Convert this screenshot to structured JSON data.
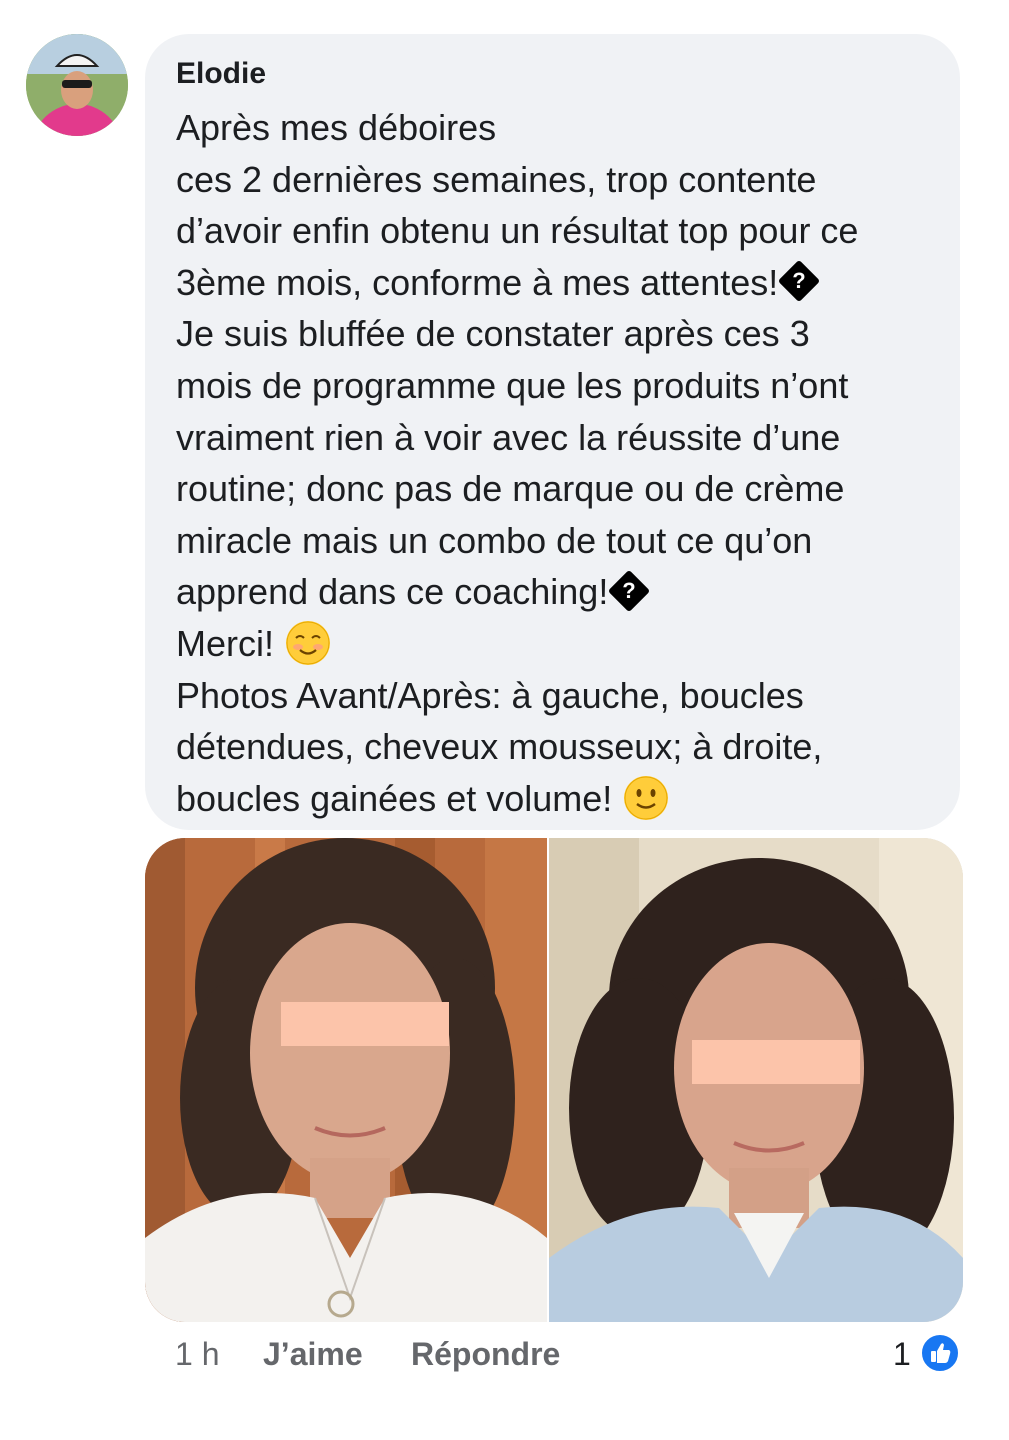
{
  "comment": {
    "author": "Elodie",
    "lines": [
      {
        "text": "Après mes déboires"
      },
      {
        "text": "ces 2 dernières semaines, trop contente"
      },
      {
        "text": "d’avoir enfin obtenu un résultat top pour ce"
      },
      {
        "text": "3ème mois, conforme à mes attentes!",
        "suffix_icon": "question-diamond-icon"
      },
      {
        "text": "Je suis bluffée de constater après ces 3"
      },
      {
        "text": "mois de programme que les produits n’ont"
      },
      {
        "text": "vraiment rien à voir avec la réussite d’une"
      },
      {
        "text": "routine; donc pas de marque ou de crème"
      },
      {
        "text": "miracle mais un combo de tout ce qu’on"
      },
      {
        "text": "apprend dans ce coaching!",
        "suffix_icon": "question-diamond-icon"
      },
      {
        "text": "Merci!",
        "suffix_icon": "smiling-face-emoji"
      },
      {
        "text": "Photos Avant/Après: à gauche, boucles"
      },
      {
        "text": "détendues, cheveux mousseux; à droite,"
      },
      {
        "text": "boucles gainées et volume!",
        "suffix_icon": "slightly-smiling-face-emoji"
      }
    ],
    "photos": [
      "before-photo-curly-hair",
      "after-photo-curly-hair"
    ],
    "footer": {
      "time": "1 h",
      "like_label": "J’aime",
      "reply_label": "Répondre",
      "reaction_count": "1",
      "reaction_icon": "like-thumb-icon"
    }
  },
  "colors": {
    "bubble_bg": "#f0f2f5",
    "text": "#1c1e21",
    "muted": "#65676b",
    "like_blue": "#1877f2",
    "censor_bar": "#fcc4aa"
  }
}
